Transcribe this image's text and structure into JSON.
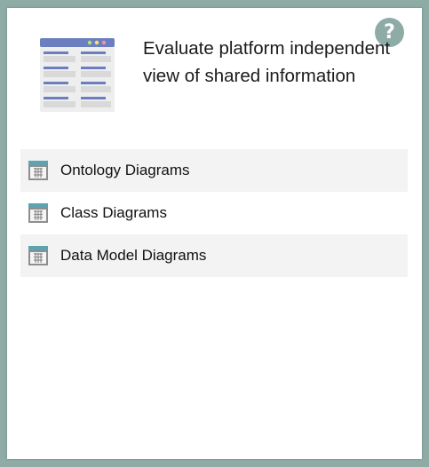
{
  "header": {
    "title": "Evaluate platform independent view of shared information",
    "help_label": "?"
  },
  "icons": {
    "help": "question-icon",
    "illustration": "table-document-icon",
    "row_icon": "diagram-grid-icon"
  },
  "colors": {
    "background": "#8eaba6",
    "accent_blue": "#6b7fc0",
    "row_shade": "#f3f3f3"
  },
  "list": {
    "items": [
      {
        "label": "Ontology Diagrams"
      },
      {
        "label": "Class Diagrams"
      },
      {
        "label": "Data Model Diagrams"
      }
    ]
  }
}
